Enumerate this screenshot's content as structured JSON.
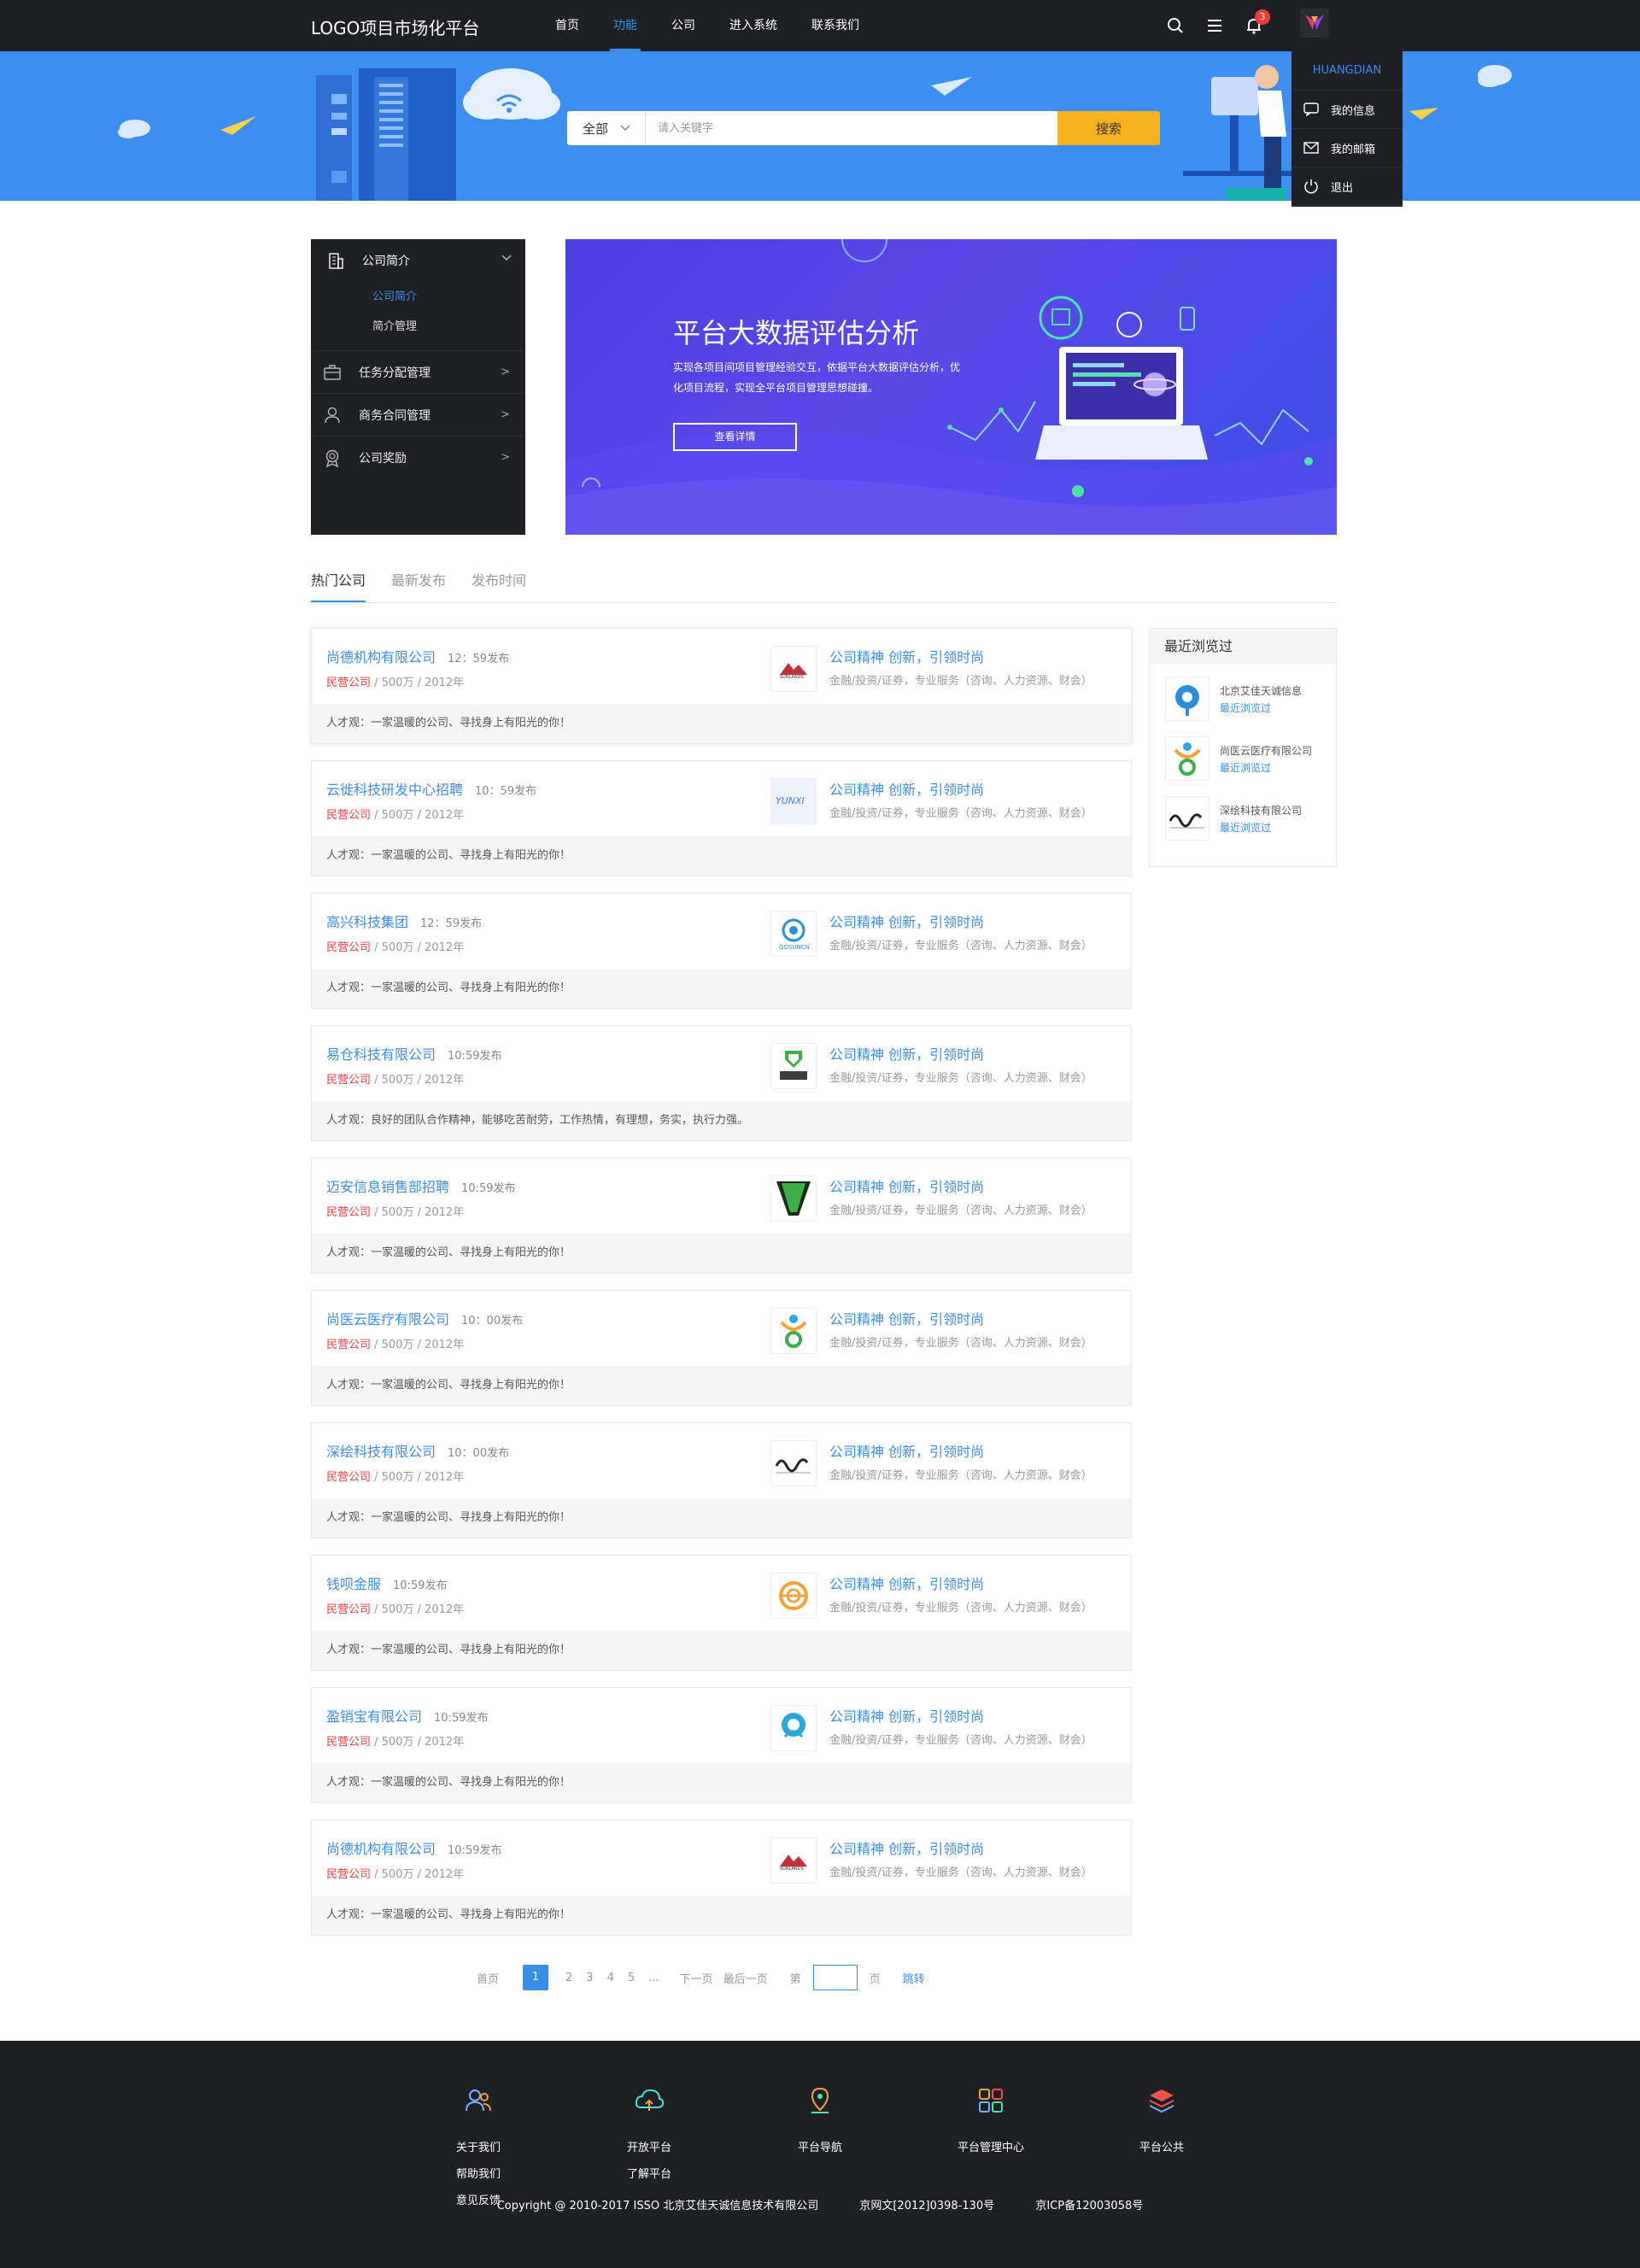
{
  "header": {
    "logo": "LOGO项目市场化平台",
    "nav": [
      {
        "label": "首页"
      },
      {
        "label": "功能"
      },
      {
        "label": "公司"
      },
      {
        "label": "进入系统"
      },
      {
        "label": "联系我们"
      }
    ],
    "active_nav": "功能",
    "notification_count": "3",
    "icons": [
      "search-icon",
      "menu-icon",
      "bell-icon",
      "avatar"
    ]
  },
  "user_menu": {
    "username": "HUANGDIAN",
    "items": [
      {
        "label": "我的信息",
        "icon": "chat-icon"
      },
      {
        "label": "我的邮箱",
        "icon": "mail-icon"
      },
      {
        "label": "退出",
        "icon": "power-icon"
      }
    ]
  },
  "search": {
    "category": "全部",
    "placeholder": "请入关键字",
    "button": "搜索"
  },
  "sidebar": {
    "head": {
      "label": "公司简介"
    },
    "subs": [
      {
        "label": "公司简介"
      },
      {
        "label": "简介管理"
      }
    ],
    "items": [
      {
        "label": "任务分配管理",
        "arrow": ">"
      },
      {
        "label": "商务合同管理",
        "arrow": ">"
      },
      {
        "label": "公司奖励",
        "arrow": ">"
      }
    ]
  },
  "promo": {
    "title": "平台大数据评估分析",
    "desc": "实现各项目间项目管理经验交互，依据平台大数据评估分析，优化项目流程，实现全平台项目管理思想碰撞。",
    "button": "查看详情"
  },
  "tabs": [
    {
      "label": "热门公司"
    },
    {
      "label": "最新发布"
    },
    {
      "label": "发布时间"
    }
  ],
  "companies": [
    {
      "name": "尚德机构有限公司",
      "time": "12：59发布",
      "type": "民营公司",
      "meta": " / 500万 / 2012年",
      "slogan": "公司精神  创新，引领时尚",
      "industry": "金融/投资/证券，专业服务（咨询、人力资源、财会）",
      "talent": "人才观：一家温暖的公司、寻找身上有阳光的你！",
      "logo_icon": "sunlands-logo-icon"
    },
    {
      "name": "云徙科技研发中心招聘",
      "time": "10：59发布",
      "type": "民营公司",
      "meta": " / 500万 / 2012年",
      "slogan": "公司精神  创新，引领时尚",
      "industry": "金融/投资/证券，专业服务（咨询、人力资源、财会）",
      "talent": "人才观：一家温暖的公司、寻找身上有阳光的你！",
      "logo_icon": "yunxi-logo-icon"
    },
    {
      "name": "高兴科技集团",
      "time": "12：59发布",
      "type": "民营公司",
      "meta": " / 500万 / 2012年",
      "slogan": "公司精神  创新，引领时尚",
      "industry": "金融/投资/证券，专业服务（咨询、人力资源、财会）",
      "talent": "人才观：一家温暖的公司、寻找身上有阳光的你！",
      "logo_icon": "gosuncn-logo-icon"
    },
    {
      "name": "易仓科技有限公司",
      "time": "10:59发布",
      "type": "民营公司",
      "meta": " / 500万 / 2012年",
      "slogan": "公司精神  创新，引领时尚",
      "industry": "金融/投资/证券，专业服务（咨询、人力资源、财会）",
      "talent": "人才观：良好的团队合作精神，能够吃苦耐劳，工作热情，有理想，务实，执行力强。",
      "logo_icon": "eccang-logo-icon"
    },
    {
      "name": "迈安信息销售部招聘",
      "time": "10:59发布",
      "type": "民营公司",
      "meta": " / 500万 / 2012年",
      "slogan": "公司精神  创新，引领时尚",
      "industry": "金融/投资/证券，专业服务（咨询、人力资源、财会）",
      "talent": "人才观：一家温暖的公司、寻找身上有阳光的你！",
      "logo_icon": "maian-logo-icon"
    },
    {
      "name": "尚医云医疗有限公司",
      "time": "10：00发布",
      "type": "民营公司",
      "meta": " / 500万 / 2012年",
      "slogan": "公司精神  创新，引领时尚",
      "industry": "金融/投资/证券，专业服务（咨询、人力资源、财会）",
      "talent": "人才观：一家温暖的公司、寻找身上有阳光的你！",
      "logo_icon": "shangyiyun-logo-icon"
    },
    {
      "name": "深绘科技有限公司",
      "time": "10：00发布",
      "type": "民营公司",
      "meta": " / 500万 / 2012年",
      "slogan": "公司精神  创新，引领时尚",
      "industry": "金融/投资/证券，专业服务（咨询、人力资源、财会）",
      "talent": "人才观：一家温暖的公司、寻找身上有阳光的你！",
      "logo_icon": "shenhui-logo-icon"
    },
    {
      "name": "钱呗金服",
      "time": "10:59发布",
      "type": "民营公司",
      "meta": " / 500万 / 2012年",
      "slogan": "公司精神  创新，引领时尚",
      "industry": "金融/投资/证券，专业服务（咨询、人力资源、财会）",
      "talent": "人才观：一家温暖的公司、寻找身上有阳光的你！",
      "logo_icon": "qianbei-logo-icon"
    },
    {
      "name": "盈销宝有限公司",
      "time": "10:59发布",
      "type": "民营公司",
      "meta": " / 500万 / 2012年",
      "slogan": "公司精神  创新，引领时尚",
      "industry": "金融/投资/证券，专业服务（咨询、人力资源、财会）",
      "talent": "人才观：一家温暖的公司、寻找身上有阳光的你！",
      "logo_icon": "yingxiaobao-logo-icon"
    },
    {
      "name": "尚德机构有限公司",
      "time": "10:59发布",
      "type": "民营公司",
      "meta": " / 500万 / 2012年",
      "slogan": "公司精神  创新，引领时尚",
      "industry": "金融/投资/证券，专业服务（咨询、人力资源、财会）",
      "talent": "人才观：一家温暖的公司、寻找身上有阳光的你！",
      "logo_icon": "sunlands-logo-icon"
    }
  ],
  "recent": {
    "title": "最近浏览过",
    "items": [
      {
        "name": "北京艾佳天诚信息",
        "link": "最近浏览过",
        "logo_icon": "aijia-logo-icon"
      },
      {
        "name": "尚医云医疗有限公司",
        "link": "最近浏览过",
        "logo_icon": "shangyiyun-logo-icon"
      },
      {
        "name": "深绘科技有限公司",
        "link": "最近浏览过",
        "logo_icon": "shenhui-logo-icon"
      }
    ]
  },
  "pagination": {
    "first": "首页",
    "pages": [
      "1",
      "2",
      "3",
      "4",
      "5",
      "..."
    ],
    "current": "1",
    "next": "下一页",
    "last": "最后一页",
    "goto_prefix": "第",
    "goto_suffix": "页",
    "jump": "跳转"
  },
  "footer": {
    "columns": [
      {
        "icon": "users-icon",
        "links": [
          "关于我们",
          "帮助我们",
          "意见反馈"
        ]
      },
      {
        "icon": "cloud-icon",
        "links": [
          "开放平台",
          "了解平台"
        ]
      },
      {
        "icon": "map-pin-icon",
        "links": [
          "平台导航"
        ]
      },
      {
        "icon": "grid-icon",
        "links": [
          "平台管理中心"
        ]
      },
      {
        "icon": "layers-icon",
        "links": [
          "平台公共"
        ]
      }
    ],
    "copyright": "Copyright @ 2010-2017 ISSO 北京艾佳天诚信息技术有限公司",
    "license": "京网文[2012]0398-130号",
    "icp": "京ICP备12003058号"
  },
  "colors": {
    "dark": "#1f2024",
    "accent": "#3a8ee6",
    "hero": "#3d8ef0",
    "search_button": "#f5b21d",
    "danger": "#f23c3c"
  }
}
